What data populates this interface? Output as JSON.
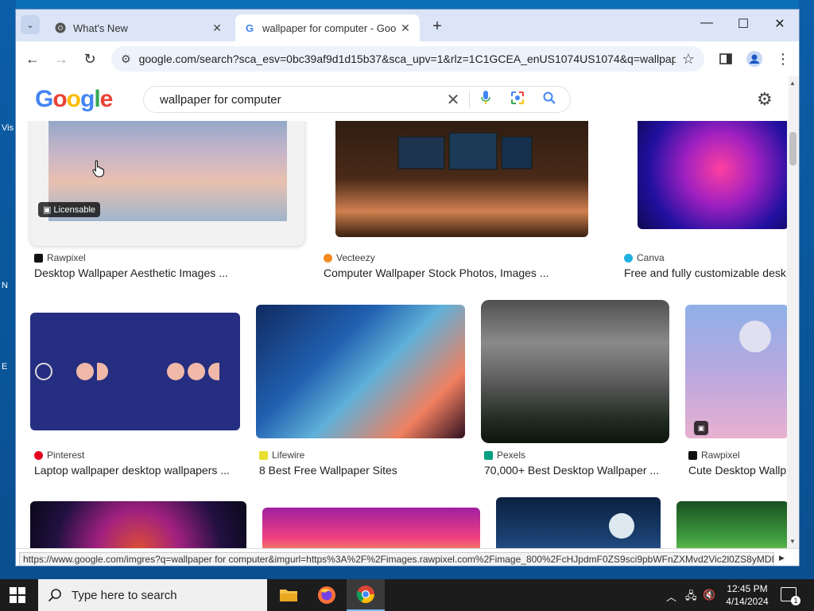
{
  "tabs": [
    {
      "title": "What's New",
      "close": "✕"
    },
    {
      "title": "wallpaper for computer - Goo",
      "close": "✕"
    }
  ],
  "window_controls": {
    "minimize": "—",
    "maximize": "☐",
    "close": "✕"
  },
  "address_bar": {
    "url": "google.com/search?sca_esv=0bc39af9d1d15b37&sca_upv=1&rlz=1C1GCEA_enUS1074US1074&q=wallpap..."
  },
  "google": {
    "logo": [
      "G",
      "o",
      "o",
      "g",
      "l",
      "e"
    ],
    "query": "wallpaper for computer"
  },
  "results": [
    {
      "source": "Rawpixel",
      "caption": "Desktop Wallpaper Aesthetic Images ...",
      "badge": "Licensable"
    },
    {
      "source": "Vecteezy",
      "caption": "Computer Wallpaper Stock Photos, Images ..."
    },
    {
      "source": "Canva",
      "caption": "Free and fully customizable desk"
    },
    {
      "source": "Pinterest",
      "caption": "Laptop wallpaper desktop wallpapers ..."
    },
    {
      "source": "Lifewire",
      "caption": "8 Best Free Wallpaper Sites"
    },
    {
      "source": "Pexels",
      "caption": "70,000+ Best Desktop Wallpaper ..."
    },
    {
      "source": "Rawpixel",
      "caption": "Cute Desktop Wallp"
    }
  ],
  "status_url": "https://www.google.com/imgres?q=wallpaper for computer&imgurl=https%3A%2F%2Fimages.rawpixel.com%2Fimage_800%2FcHJpdmF0ZS9sci9pbWFnZXMvd2Vic2l0ZS8yMDIz...",
  "taskbar": {
    "search_placeholder": "Type here to search",
    "time": "12:45 PM",
    "date": "4/14/2024",
    "notification_count": "1"
  },
  "desktop_icon_labels": [
    "Vis",
    "N",
    "E"
  ]
}
